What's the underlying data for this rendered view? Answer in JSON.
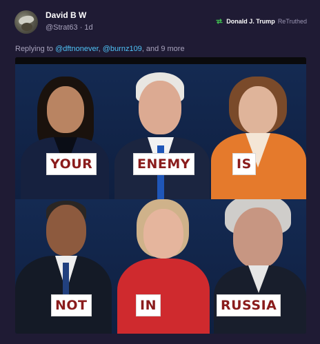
{
  "post": {
    "display_name": "David B W",
    "handle": "@Strat63",
    "separator": " · ",
    "time_ago": "1d",
    "retruth": {
      "name": "Donald J. Trump",
      "label": "ReTruthed",
      "icon": "retruth-icon",
      "icon_color": "#3fb950"
    },
    "replying": {
      "prefix": "Replying to ",
      "mention_1": "@dftnonever",
      "comma": ", ",
      "mention_2": "@burnz109",
      "suffix": ", and 9 more"
    },
    "meme": {
      "words": [
        "YOUR",
        "ENEMY",
        "IS",
        "NOT",
        "IN",
        "RUSSIA"
      ]
    }
  },
  "colors": {
    "background": "#1f1b34",
    "mention": "#4fc3f7",
    "meme_text": "#8a1c1c",
    "meme_background": "#0f1d3a"
  }
}
